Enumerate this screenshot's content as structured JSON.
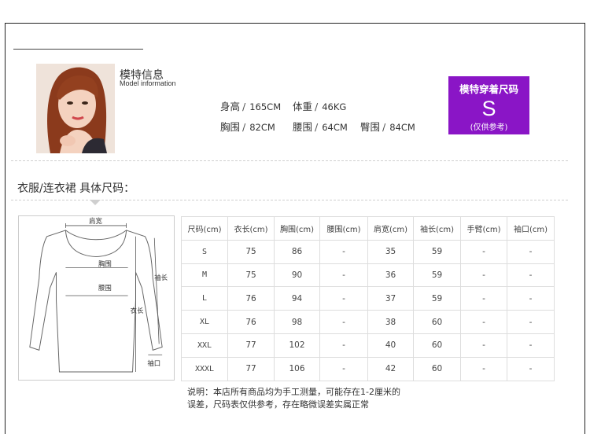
{
  "model": {
    "title": "模特信息",
    "subtitle": "Model information",
    "height_label": "身高",
    "height_value": "165CM",
    "weight_label": "体重",
    "weight_value": "46KG",
    "chest_label": "胸围",
    "chest_value": "82CM",
    "waist_label": "腰围",
    "waist_value": "64CM",
    "hip_label": "臀围",
    "hip_value": "84CM"
  },
  "size_box": {
    "title": "模特穿着尺码",
    "size": "S",
    "note": "(仅供参考)",
    "color": "#8a15c6"
  },
  "section": {
    "title": "衣服/连衣裙 具体尺码："
  },
  "diagram": {
    "shoulder": "肩宽",
    "chest": "胸围",
    "waist": "腰围",
    "sleeve": "袖长",
    "length": "衣长",
    "cuff": "袖口"
  },
  "table": {
    "headers": [
      "尺码(cm)",
      "衣长(cm)",
      "胸围(cm)",
      "腰围(cm)",
      "肩宽(cm)",
      "袖长(cm)",
      "手臂(cm)",
      "袖口(cm)"
    ],
    "rows": [
      [
        "S",
        "75",
        "86",
        "-",
        "35",
        "59",
        "-",
        "-"
      ],
      [
        "M",
        "75",
        "90",
        "-",
        "36",
        "59",
        "-",
        "-"
      ],
      [
        "L",
        "76",
        "94",
        "-",
        "37",
        "59",
        "-",
        "-"
      ],
      [
        "XL",
        "76",
        "98",
        "-",
        "38",
        "60",
        "-",
        "-"
      ],
      [
        "XXL",
        "77",
        "102",
        "-",
        "40",
        "60",
        "-",
        "-"
      ],
      [
        "XXXL",
        "77",
        "106",
        "-",
        "42",
        "60",
        "-",
        "-"
      ]
    ]
  },
  "note": {
    "line1": "说明：本店所有商品均为手工测量，可能存在1-2厘米的",
    "line2": "误差，尺码表仅供参考，存在略微误差实属正常"
  }
}
